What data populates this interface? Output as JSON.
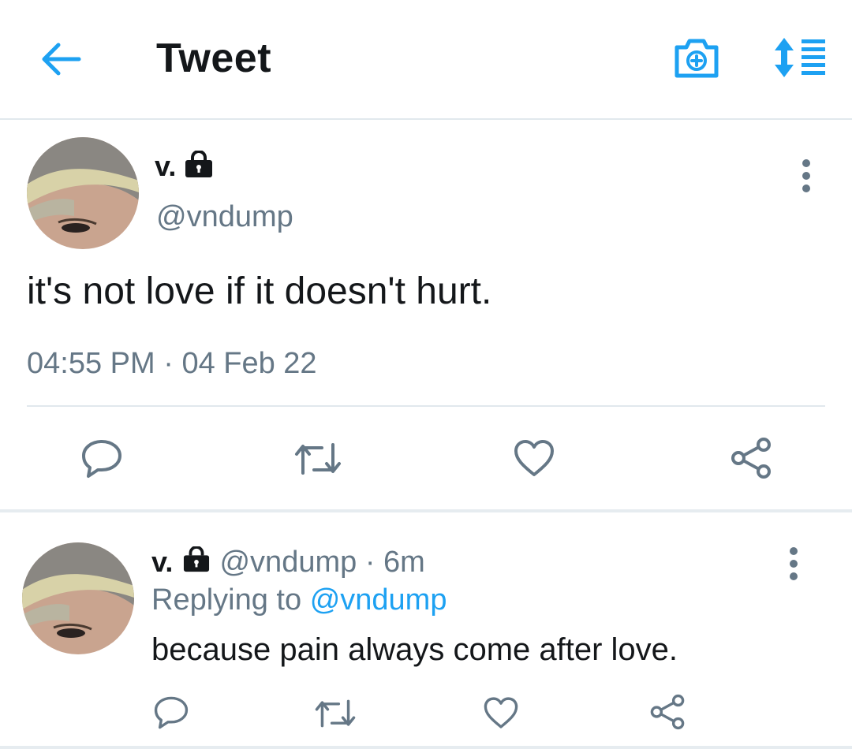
{
  "header": {
    "title": "Tweet",
    "back_icon": "arrow-left-icon",
    "camera_icon": "camera-add-icon",
    "sort_icon": "sort-list-icon",
    "accent": "#1da1f2"
  },
  "tweet": {
    "display_name": "v.",
    "handle": "@vndump",
    "text": "it's not love if it doesn't hurt.",
    "time": "04:55 PM",
    "separator": "·",
    "date": "04 Feb 22",
    "protected_icon": "lock-icon"
  },
  "reply": {
    "display_name": "v.",
    "handle": "@vndump",
    "separator": "·",
    "age": "6m",
    "replying_prefix": "Replying to",
    "replying_to": "@vndump",
    "text": "because pain always come after love."
  },
  "actions": [
    "reply-icon",
    "retweet-icon",
    "like-icon",
    "share-icon"
  ],
  "colors": {
    "text": "#14171a",
    "secondary": "#657786",
    "divider": "#e1e8ed"
  }
}
